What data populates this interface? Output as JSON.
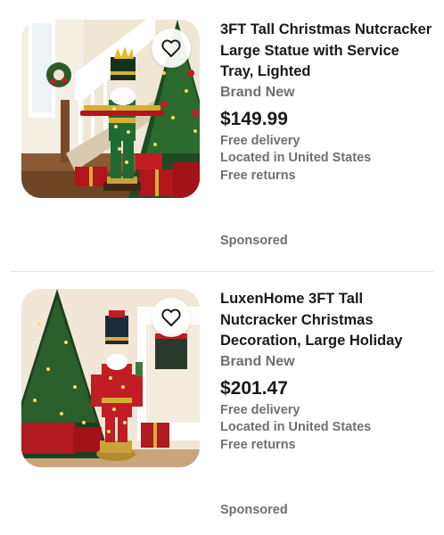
{
  "listings": [
    {
      "title": "3FT Tall Christmas Nutcracker Large Statue with Service Tray, Lighted",
      "condition": "Brand New",
      "price": "$149.99",
      "delivery": "Free delivery",
      "location": "Located in United States",
      "returns": "Free returns",
      "sponsored": "Sponsored",
      "watch_icon": "heart-icon"
    },
    {
      "title": "LuxenHome 3FT Tall Nutcracker Christmas Decoration, Large Holiday",
      "condition": "Brand New",
      "price": "$201.47",
      "delivery": "Free delivery",
      "location": "Located in United States",
      "returns": "Free returns",
      "sponsored": "Sponsored",
      "watch_icon": "heart-icon"
    }
  ],
  "colors": {
    "title": "#191919",
    "secondary": "#707070",
    "divider": "#e3e3e3"
  }
}
